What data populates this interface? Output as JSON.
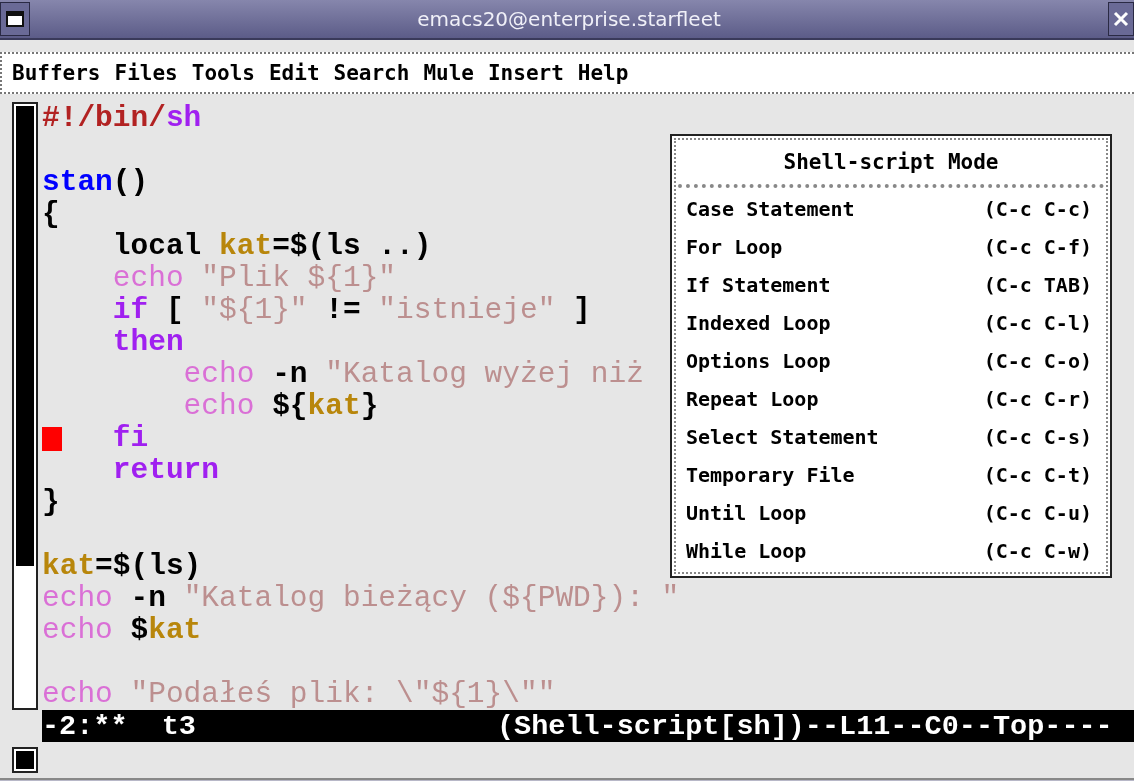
{
  "window": {
    "title": "emacs20@enterprise.starfleet"
  },
  "menu_bar": [
    "Buffers",
    "Files",
    "Tools",
    "Edit",
    "Search",
    "Mule",
    "Insert",
    "Help"
  ],
  "editor": {
    "lines": [
      {
        "kind": "code",
        "cursor": false,
        "tokens": [
          {
            "text": "#!/bin/",
            "kind": "comment"
          },
          {
            "text": "sh",
            "kind": "keyword"
          }
        ]
      },
      {
        "kind": "blank"
      },
      {
        "kind": "code",
        "cursor": false,
        "tokens": [
          {
            "text": "stan",
            "kind": "function"
          },
          {
            "text": "()",
            "kind": "plain"
          }
        ]
      },
      {
        "kind": "code",
        "cursor": false,
        "tokens": [
          {
            "text": "{",
            "kind": "plain"
          }
        ]
      },
      {
        "kind": "code",
        "cursor": false,
        "tokens": [
          {
            "text": "    local ",
            "kind": "plain"
          },
          {
            "text": "kat",
            "kind": "variable"
          },
          {
            "text": "=$(ls ..)",
            "kind": "plain"
          }
        ]
      },
      {
        "kind": "code",
        "cursor": false,
        "tokens": [
          {
            "text": "    echo",
            "kind": "builtin"
          },
          {
            "text": " \"Plik ${1}\"",
            "kind": "string"
          }
        ]
      },
      {
        "kind": "code",
        "cursor": false,
        "tokens": [
          {
            "text": "    if",
            "kind": "keyword"
          },
          {
            "text": " [ ",
            "kind": "plain"
          },
          {
            "text": "\"${1}\"",
            "kind": "string"
          },
          {
            "text": " != ",
            "kind": "plain"
          },
          {
            "text": "\"istnieje\"",
            "kind": "string"
          },
          {
            "text": " ]",
            "kind": "plain"
          }
        ]
      },
      {
        "kind": "code",
        "cursor": false,
        "tokens": [
          {
            "text": "    then",
            "kind": "keyword"
          }
        ]
      },
      {
        "kind": "code",
        "cursor": false,
        "tokens": [
          {
            "text": "        echo",
            "kind": "builtin"
          },
          {
            "text": " -n ",
            "kind": "plain"
          },
          {
            "text": "\"Katalog wyżej niż",
            "kind": "string"
          }
        ]
      },
      {
        "kind": "code",
        "cursor": false,
        "tokens": [
          {
            "text": "        echo",
            "kind": "builtin"
          },
          {
            "text": " ${",
            "kind": "plain"
          },
          {
            "text": "kat",
            "kind": "variable"
          },
          {
            "text": "}",
            "kind": "plain"
          }
        ]
      },
      {
        "kind": "code",
        "cursor": true,
        "tokens": [
          {
            "text": "    fi",
            "kind": "keyword"
          }
        ]
      },
      {
        "kind": "code",
        "cursor": false,
        "tokens": [
          {
            "text": "    return",
            "kind": "keyword"
          }
        ]
      },
      {
        "kind": "code",
        "cursor": false,
        "tokens": [
          {
            "text": "}",
            "kind": "plain"
          }
        ]
      },
      {
        "kind": "blank"
      },
      {
        "kind": "code",
        "cursor": false,
        "tokens": [
          {
            "text": "kat",
            "kind": "variable"
          },
          {
            "text": "=$(ls)",
            "kind": "plain"
          }
        ]
      },
      {
        "kind": "code",
        "cursor": false,
        "tokens": [
          {
            "text": "echo",
            "kind": "builtin"
          },
          {
            "text": " -n ",
            "kind": "plain"
          },
          {
            "text": "\"Katalog bieżący (${PWD}): \"",
            "kind": "string"
          }
        ]
      },
      {
        "kind": "code",
        "cursor": false,
        "tokens": [
          {
            "text": "echo",
            "kind": "builtin"
          },
          {
            "text": " $",
            "kind": "plain"
          },
          {
            "text": "kat",
            "kind": "variable"
          }
        ]
      },
      {
        "kind": "blank"
      },
      {
        "kind": "code",
        "cursor": false,
        "tokens": [
          {
            "text": "echo",
            "kind": "builtin"
          },
          {
            "text": " \"Podałeś plik: \\\"${1}\\\"\"",
            "kind": "string"
          }
        ]
      }
    ]
  },
  "popup_menu": {
    "title": "Shell-script Mode",
    "items": [
      {
        "label": "Case Statement",
        "shortcut": "(C-c C-c)"
      },
      {
        "label": "For Loop",
        "shortcut": "(C-c C-f)"
      },
      {
        "label": "If Statement",
        "shortcut": "(C-c TAB)"
      },
      {
        "label": "Indexed Loop",
        "shortcut": "(C-c C-l)"
      },
      {
        "label": "Options Loop",
        "shortcut": "(C-c C-o)"
      },
      {
        "label": "Repeat Loop",
        "shortcut": "(C-c C-r)"
      },
      {
        "label": "Select Statement",
        "shortcut": "(C-c C-s)"
      },
      {
        "label": "Temporary File",
        "shortcut": "(C-c C-t)"
      },
      {
        "label": "Until Loop",
        "shortcut": "(C-c C-u)"
      },
      {
        "label": "While Loop",
        "shortcut": "(C-c C-w)"
      }
    ]
  },
  "mode_line": {
    "buffer_status": "-2:**  t3",
    "mode_info": "(Shell-script[sh])--L11--C0--Top----"
  }
}
